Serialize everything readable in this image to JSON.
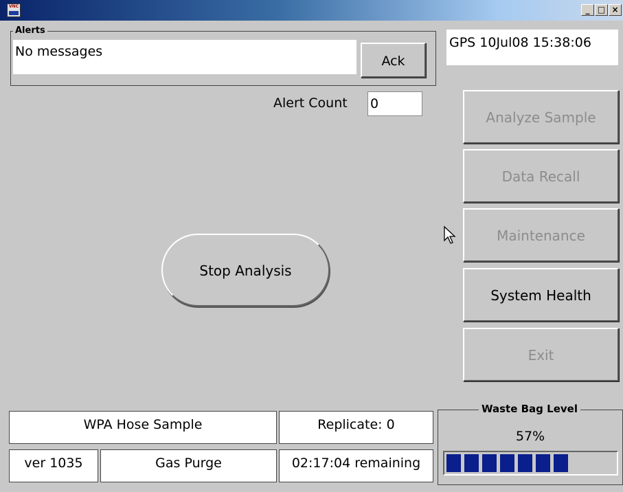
{
  "window": {
    "icon": "vnc-icon",
    "minimize_label": "_",
    "maximize_label": "□",
    "close_label": "×"
  },
  "alerts": {
    "legend": "Alerts",
    "message": "No messages",
    "ack_label": "Ack"
  },
  "gps": "GPS 10Jul08 15:38:06",
  "alert_count": {
    "label": "Alert Count",
    "value": "0"
  },
  "side_buttons": [
    {
      "label": "Analyze Sample",
      "enabled": false
    },
    {
      "label": "Data Recall",
      "enabled": false
    },
    {
      "label": "Maintenance",
      "enabled": false
    },
    {
      "label": "System Health",
      "enabled": true
    },
    {
      "label": "Exit",
      "enabled": false
    }
  ],
  "stop_label": "Stop Analysis",
  "status": {
    "sample": "WPA Hose Sample",
    "replicate": "Replicate: 0",
    "version": "ver 1035",
    "phase": "Gas Purge",
    "remaining": "02:17:04 remaining"
  },
  "waste_bag": {
    "legend": "Waste Bag Level",
    "percent_text": "57%",
    "level": 0.57,
    "fill_color": "#0a1e8c"
  }
}
